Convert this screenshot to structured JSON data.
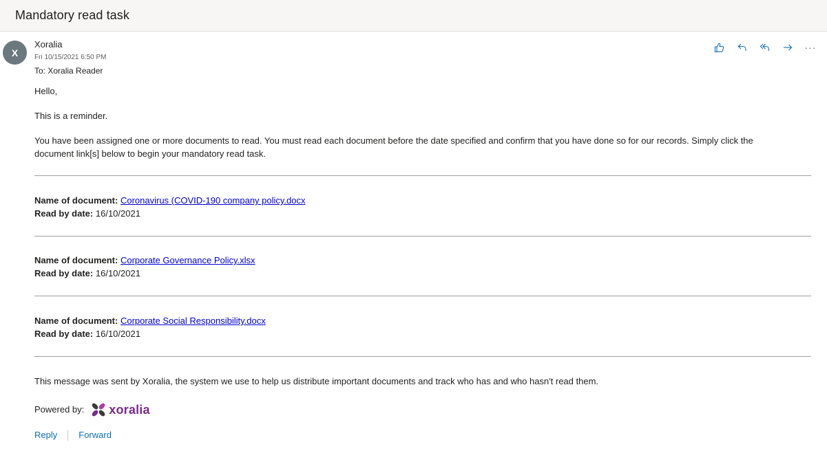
{
  "subject": "Mandatory read task",
  "sender": {
    "initial": "X",
    "name": "Xoralia",
    "date": "Fri 10/15/2021 6:50 PM",
    "to": "To:  Xoralia Reader"
  },
  "actions": {
    "icons": [
      "like-icon",
      "reply-icon",
      "reply-all-icon",
      "forward-icon",
      "more-icon"
    ],
    "more_label": "···"
  },
  "body": {
    "greeting": "Hello,",
    "reminder": "This is a reminder.",
    "intro": "You have been assigned one or more documents to read. You must read each document before the date specified and confirm that you have done so for our records. Simply click the document link[s] below to begin your mandatory read task.",
    "documents": [
      {
        "name_label": "Name of document:",
        "name": "Coronavirus (COVID-190 company policy.docx",
        "date_label": "Read by date:",
        "date": "16/10/2021"
      },
      {
        "name_label": "Name of document:",
        "name": "Corporate Governance Policy.xlsx",
        "date_label": "Read by date:",
        "date": "16/10/2021"
      },
      {
        "name_label": "Name of document:",
        "name": "Corporate Social Responsibility.docx",
        "date_label": "Read by date:",
        "date": "16/10/2021"
      }
    ],
    "footer": "This message was sent by Xoralia, the system we use to help us distribute important documents and track who has and who hasn't read them.",
    "powered_by": "Powered by:",
    "logo_text": "xoralia"
  },
  "reply_bar": {
    "reply": "Reply",
    "forward": "Forward"
  },
  "colors": {
    "link": "#0000cc",
    "accent": "#0f6cbd",
    "avatar": "#69797e",
    "logo": "#7a2a8c"
  }
}
